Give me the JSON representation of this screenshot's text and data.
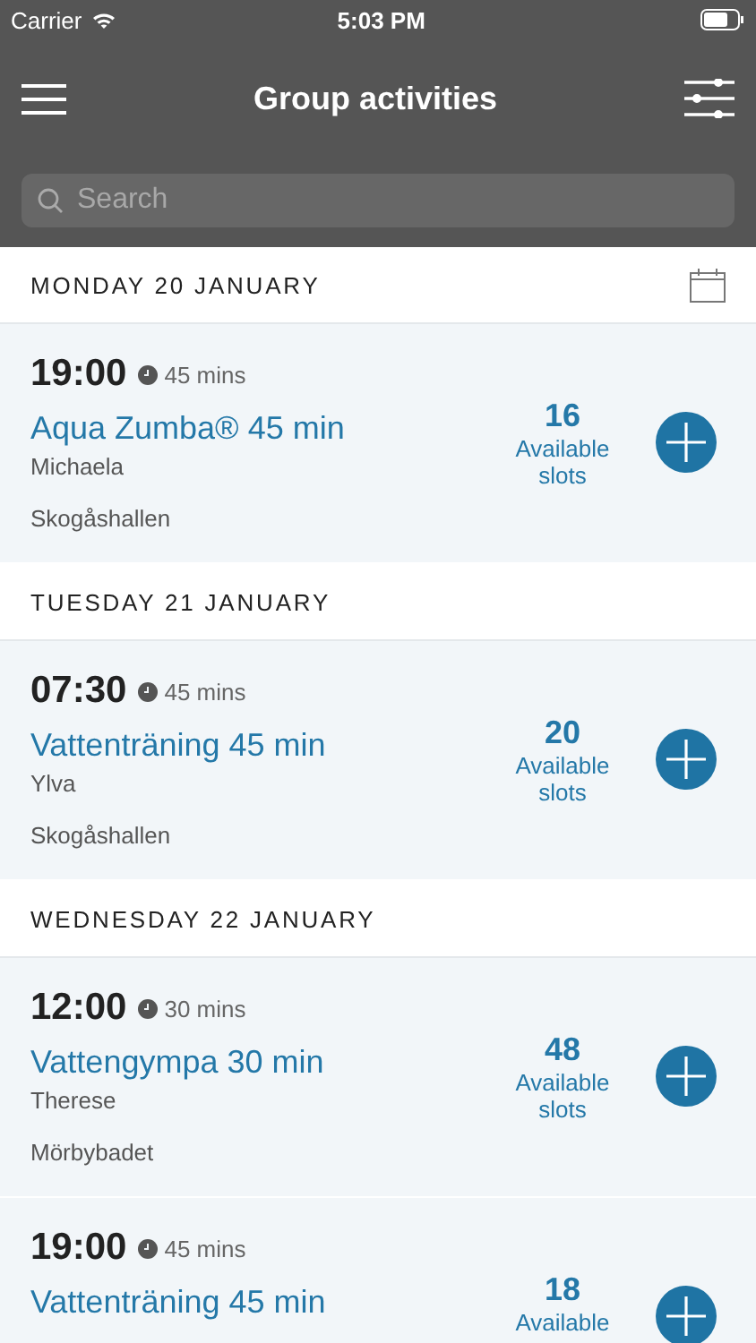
{
  "status_bar": {
    "carrier": "Carrier",
    "time": "5:03 PM"
  },
  "header": {
    "title": "Group activities"
  },
  "search": {
    "placeholder": "Search"
  },
  "days": [
    {
      "label": "MONDAY 20 JANUARY",
      "calendar_icon": true,
      "activities": [
        {
          "time": "19:00",
          "duration": "45 mins",
          "title": "Aqua Zumba® 45 min",
          "instructor": "Michaela",
          "location": "Skogåshallen",
          "slots": "16",
          "slots_label": [
            "Available",
            "slots"
          ]
        }
      ]
    },
    {
      "label": "TUESDAY 21 JANUARY",
      "calendar_icon": false,
      "activities": [
        {
          "time": "07:30",
          "duration": "45 mins",
          "title": "Vattenträning 45 min",
          "instructor": "Ylva",
          "location": "Skogåshallen",
          "slots": "20",
          "slots_label": [
            "Available",
            "slots"
          ]
        }
      ]
    },
    {
      "label": "WEDNESDAY 22 JANUARY",
      "calendar_icon": false,
      "activities": [
        {
          "time": "12:00",
          "duration": "30 mins",
          "title": "Vattengympa 30 min",
          "instructor": "Therese",
          "location": "Mörbybadet",
          "slots": "48",
          "slots_label": [
            "Available",
            "slots"
          ]
        },
        {
          "time": "19:00",
          "duration": "45 mins",
          "title": "Vattenträning 45 min",
          "slots": "18",
          "slots_label": [
            "Available"
          ]
        }
      ]
    }
  ]
}
